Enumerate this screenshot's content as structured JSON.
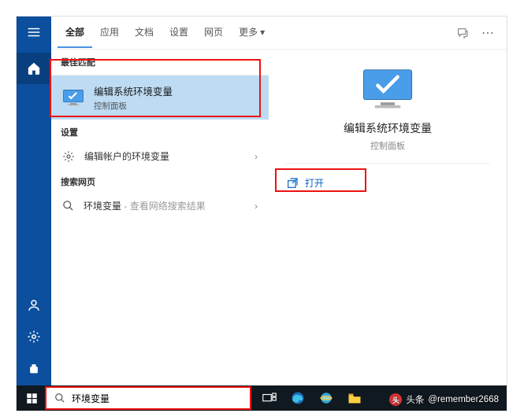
{
  "tabs": {
    "all": "全部",
    "apps": "应用",
    "documents": "文档",
    "settings": "设置",
    "web": "网页",
    "more": "更多"
  },
  "sections": {
    "best_match": "最佳匹配",
    "settings": "设置",
    "search_web": "搜索网页"
  },
  "best_match": {
    "title": "编辑系统环境变量",
    "subtitle": "控制面板"
  },
  "settings_item": {
    "label": "编辑帐户的环境变量"
  },
  "web_item": {
    "query": "环境变量",
    "suffix": "- 查看网络搜索结果"
  },
  "detail": {
    "title": "编辑系统环境变量",
    "subtitle": "控制面板",
    "open": "打开"
  },
  "search": {
    "value": "环境变量"
  },
  "watermark": {
    "prefix": "头条",
    "handle": "@remember2668"
  }
}
